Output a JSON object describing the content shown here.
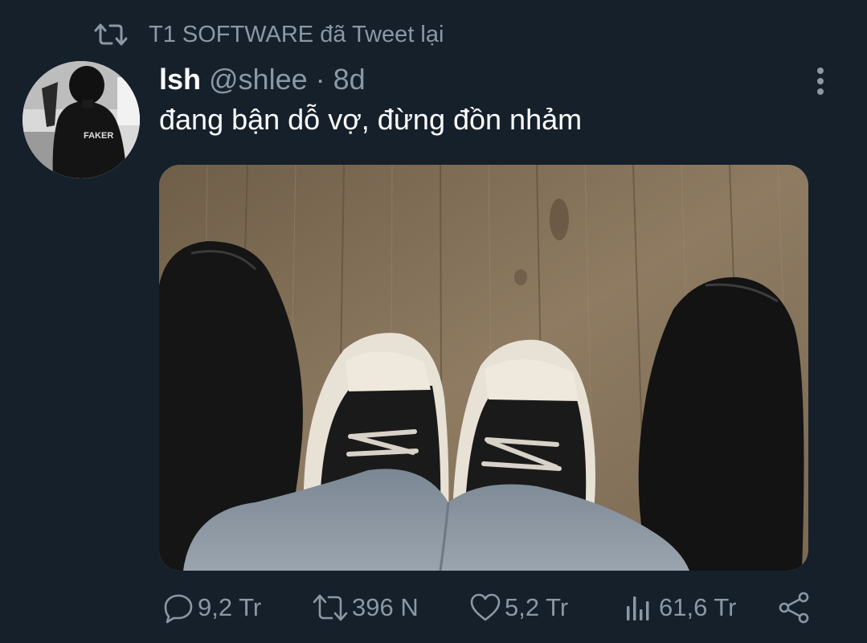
{
  "retweet_context": {
    "icon": "retweet-icon",
    "text": "T1 SOFTWARE đã Tweet lại"
  },
  "author": {
    "display_name": "lsh",
    "handle": "@shlee",
    "separator": "·",
    "time": "8d",
    "avatar_jacket_text": "FAKER"
  },
  "tweet": {
    "text": "đang bận dỗ vợ, đừng đồn nhảm"
  },
  "menu": {
    "icon": "more-vertical-icon"
  },
  "actions": {
    "reply": {
      "icon": "reply-icon",
      "count": "9,2 Tr"
    },
    "retweet": {
      "icon": "retweet-icon",
      "count": "396 N"
    },
    "like": {
      "icon": "heart-icon",
      "count": "5,2 Tr"
    },
    "views": {
      "icon": "analytics-icon",
      "count": "61,6 Tr"
    },
    "share": {
      "icon": "share-icon"
    }
  },
  "colors": {
    "background": "#15202b",
    "primary_text": "#ffffff",
    "secondary_text": "#8b98a5"
  }
}
